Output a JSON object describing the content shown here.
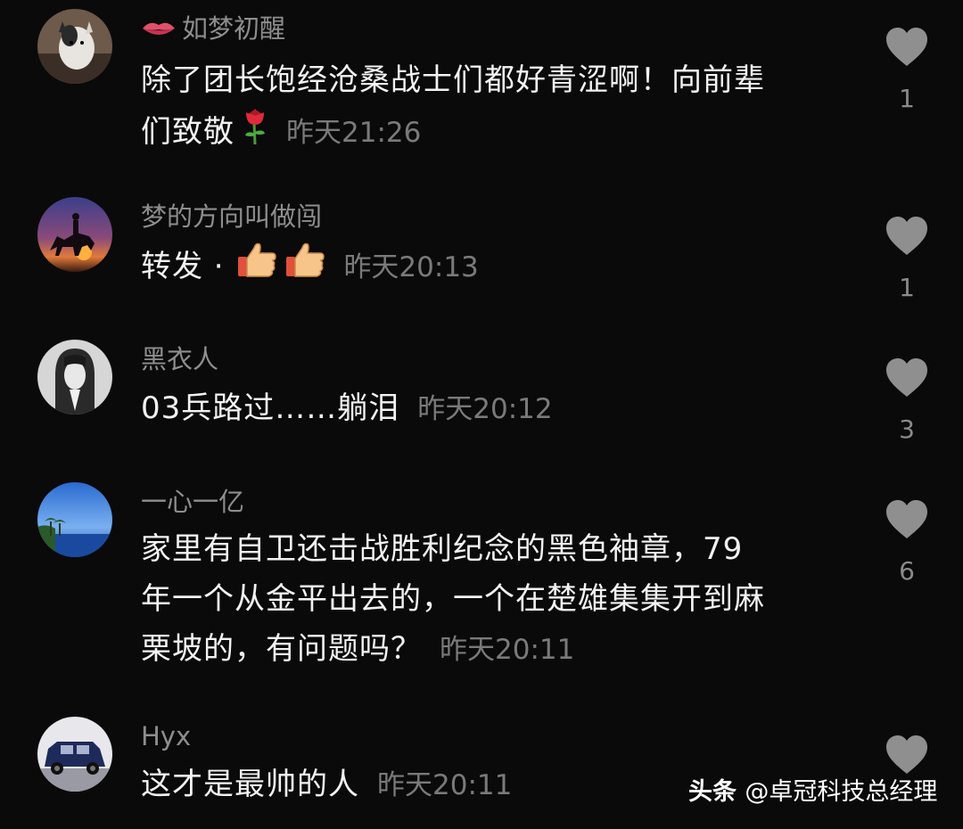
{
  "comments": [
    {
      "username": "如梦初醒",
      "username_prefix_icon": "lips-icon",
      "text_lines": [
        "除了团长饱经沧桑战士们都好青涩啊！向前辈",
        "们致敬"
      ],
      "emoji": "rose-icon",
      "time": "昨天21:26",
      "likes": "1"
    },
    {
      "username": "梦的方向叫做闯",
      "text_lines": [
        "转发 · "
      ],
      "emoji": "thumbs-up-icon",
      "time": "昨天20:13",
      "likes": "1"
    },
    {
      "username": "黑衣人",
      "text_lines": [
        "03兵路过……躺泪"
      ],
      "time": "昨天20:12",
      "likes": "3"
    },
    {
      "username": "一心一亿",
      "text_lines": [
        "家里有自卫还击战胜利纪念的黑色袖章，79",
        "年一个从金平出去的，一个在楚雄集集开到麻",
        "栗坡的，有问题吗？"
      ],
      "time": "昨天20:11",
      "likes": "6"
    },
    {
      "username": "Hyx",
      "text_lines": [
        "这才是最帅的人"
      ],
      "time": "昨天20:11",
      "likes": ""
    }
  ],
  "watermark": {
    "brand": "头条",
    "handle": "@卓冠科技总经理"
  },
  "colors": {
    "background": "#0a0a0a",
    "username": "#8e8e8e",
    "text": "#f2f2f2",
    "time": "#7a7a7a",
    "heart": "#8f8f8f"
  }
}
